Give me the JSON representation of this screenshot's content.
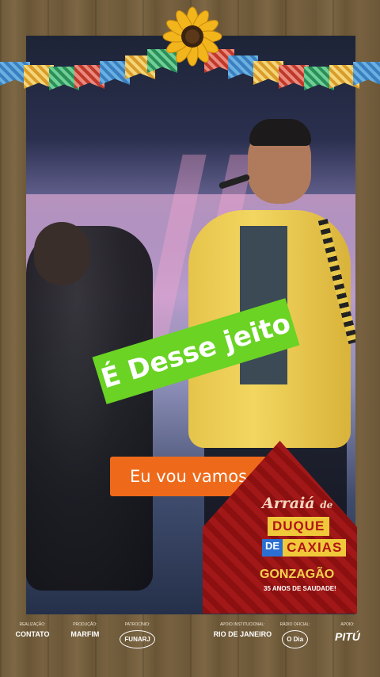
{
  "captions": {
    "green": "É Desse jeito",
    "orange": "Eu vou vamos"
  },
  "badge": {
    "line1": "Arraiá",
    "line1_suffix": "de",
    "duque": "DUQUE",
    "de": "DE",
    "caxias": "CAXIAS",
    "gonzagao": "GONZAGÃO",
    "subtitle": "35 ANOS DE SAUDADE!"
  },
  "sponsors": [
    {
      "label": "REALIZAÇÃO:",
      "logo": "CONTATO"
    },
    {
      "label": "PRODUÇÃO:",
      "logo": "MARFIM"
    },
    {
      "label": "PATROCÍNIO:",
      "logo": "FUNARJ"
    },
    {
      "label": "",
      "logo": ""
    },
    {
      "label": "APOIO INSTITUCIONAL:",
      "logo": "RIO DE JANEIRO"
    },
    {
      "label": "RÁDIO OFICIAL:",
      "logo": "O Dia"
    },
    {
      "label": "APOIO:",
      "logo": "PITÚ"
    }
  ],
  "colors": {
    "caption_green": "#6ad324",
    "caption_orange": "#ee6a1a",
    "badge_red": "#a21818",
    "badge_yellow": "#f0c93a"
  }
}
